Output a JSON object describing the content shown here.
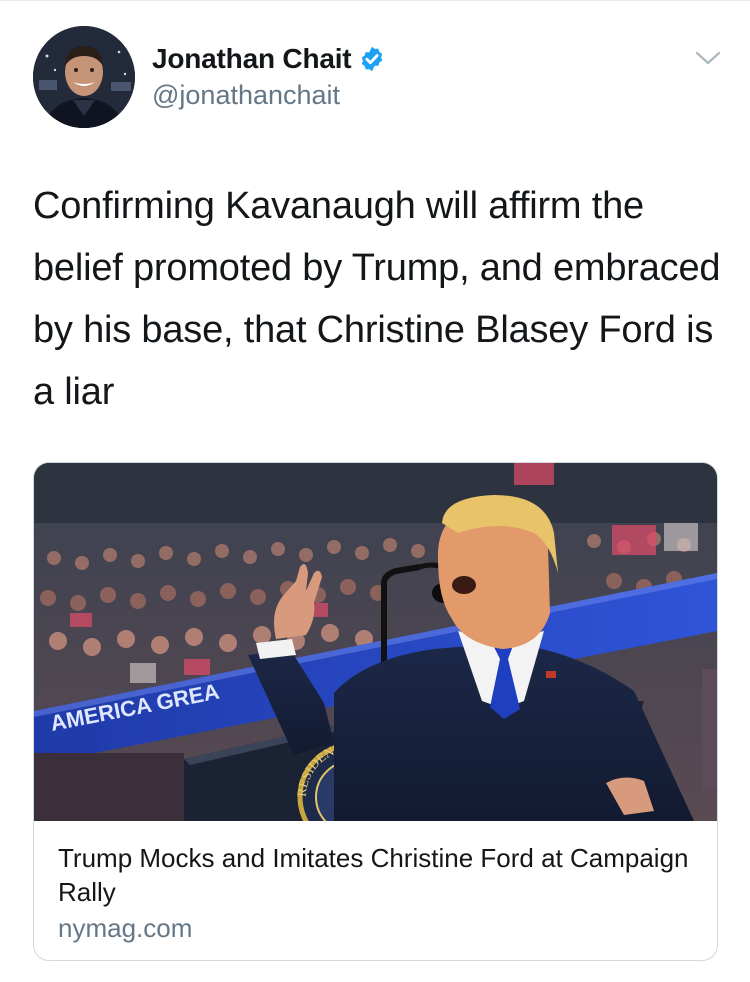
{
  "tweet": {
    "author": {
      "display_name": "Jonathan Chait",
      "handle": "@jonathanchait",
      "verified": true,
      "avatar_icon": "profile-photo"
    },
    "text": "Confirming Kavanaugh will affirm the belief promoted by Trump, and embraced by his base, that Christine Blasey Ford is a liar",
    "menu_icon": "chevron-down-icon"
  },
  "card": {
    "title": "Trump Mocks and Imitates Christine Ford at Campaign Rally",
    "domain": "nymag.com",
    "image": {
      "banner_text": "AMERICA GREA",
      "seal_text": "RESIDENT OF THE UNITE"
    }
  },
  "colors": {
    "verified_blue": "#1da1f2",
    "secondary_text": "#657786",
    "primary_text": "#14171a",
    "border": "#cfd9de"
  }
}
